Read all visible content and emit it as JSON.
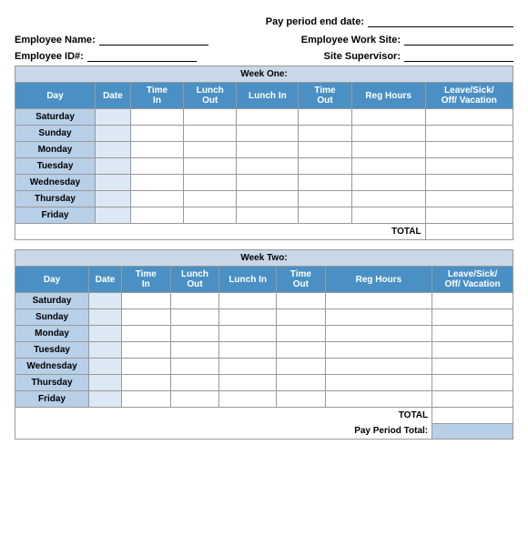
{
  "form": {
    "pay_period_label": "Pay period end date:",
    "employee_name_label": "Employee Name:",
    "employee_work_site_label": "Employee Work Site:",
    "employee_id_label": "Employee ID#:",
    "site_supervisor_label": "Site Supervisor:"
  },
  "week_one": {
    "title": "Week One:",
    "columns": [
      "Day",
      "Date",
      "Time\nIn",
      "Lunch\nOut",
      "Lunch In",
      "Time\nOut",
      "Reg Hours",
      "Leave/Sick/\nOff/ Vacation"
    ],
    "days": [
      "Saturday",
      "Sunday",
      "Monday",
      "Tuesday",
      "Wednesday",
      "Thursday",
      "Friday"
    ],
    "total_label": "TOTAL"
  },
  "week_two": {
    "title": "Week Two:",
    "days": [
      "Saturday",
      "Sunday",
      "Monday",
      "Tuesday",
      "Wednesday",
      "Thursday",
      "Friday"
    ],
    "total_label": "TOTAL"
  },
  "pay_period_total_label": "Pay Period Total:"
}
